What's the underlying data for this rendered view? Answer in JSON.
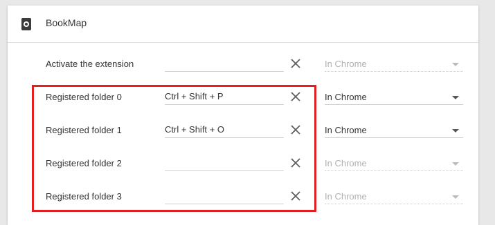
{
  "extension": {
    "name": "BookMap",
    "icon": "extension-icon"
  },
  "rows": [
    {
      "label": "Activate the extension",
      "shortcut": "",
      "scope": "In Chrome",
      "scope_enabled": false,
      "clear_icon": "close-icon"
    },
    {
      "label": "Registered folder 0",
      "shortcut": "Ctrl + Shift + P",
      "scope": "In Chrome",
      "scope_enabled": true,
      "clear_icon": "close-icon"
    },
    {
      "label": "Registered folder 1",
      "shortcut": "Ctrl + Shift + O",
      "scope": "In Chrome",
      "scope_enabled": true,
      "clear_icon": "close-icon"
    },
    {
      "label": "Registered folder 2",
      "shortcut": "",
      "scope": "In Chrome",
      "scope_enabled": false,
      "clear_icon": "close-icon"
    },
    {
      "label": "Registered folder 3",
      "shortcut": "",
      "scope": "In Chrome",
      "scope_enabled": false,
      "clear_icon": "close-icon"
    }
  ],
  "colors": {
    "highlight": "#e02020",
    "card_bg": "#ffffff",
    "page_bg": "#e8e8e8"
  }
}
